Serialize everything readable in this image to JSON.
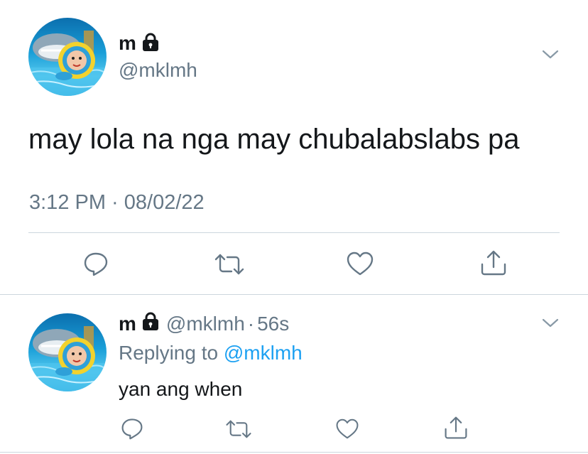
{
  "main_tweet": {
    "display_name": "m",
    "handle": "@mklmh",
    "text": "may lola na nga may chubalabslabs pa",
    "timestamp": "3:12 PM · 08/02/22",
    "protected_icon": "lock-icon",
    "menu_icon": "chevron-down-icon"
  },
  "actions": [
    "reply-icon",
    "retweet-icon",
    "like-icon",
    "share-icon"
  ],
  "reply_tweet": {
    "display_name": "m",
    "handle": "@mklmh",
    "separator": "·",
    "age": "56s",
    "replying_prefix": "Replying to",
    "replying_handle": "@mklmh",
    "text": "yan ang when",
    "protected_icon": "lock-icon",
    "menu_icon": "chevron-down-icon"
  },
  "colors": {
    "text": "#14171a",
    "muted": "#657786",
    "link": "#1da1f2",
    "divider": "#ccd6dd"
  }
}
